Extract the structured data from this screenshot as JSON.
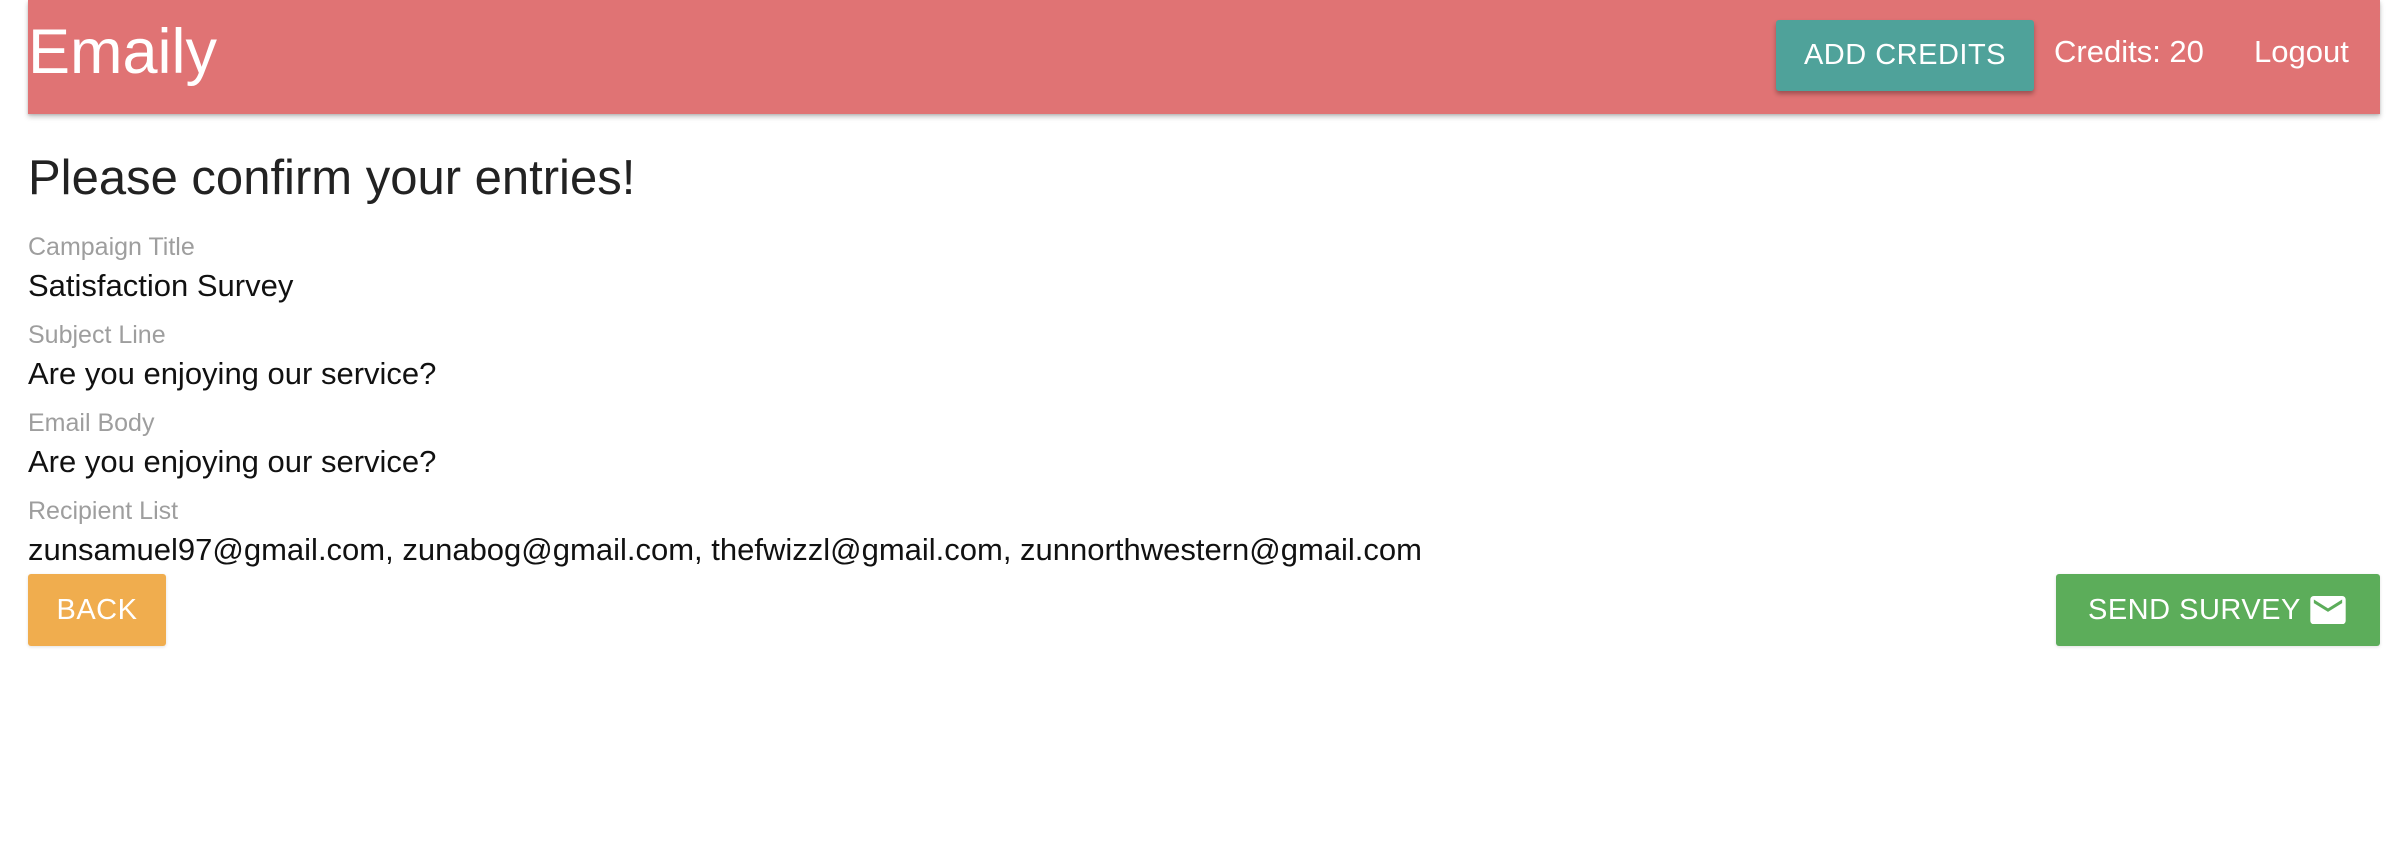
{
  "header": {
    "brand": "Emaily",
    "add_credits_label": "ADD CREDITS",
    "credits_text": "Credits: 20",
    "logout_label": "Logout"
  },
  "main": {
    "title": "Please confirm your entries!",
    "fields": [
      {
        "label": "Campaign Title",
        "value": "Satisfaction Survey"
      },
      {
        "label": "Subject Line",
        "value": "Are you enjoying our service?"
      },
      {
        "label": "Email Body",
        "value": "Are you enjoying our service?"
      },
      {
        "label": "Recipient List",
        "value": "zunsamuel97@gmail.com, zunabog@gmail.com, thefwizzl@gmail.com, zunnorthwestern@gmail.com"
      }
    ],
    "back_label": "BACK",
    "send_label": "SEND SURVEY",
    "send_icon": "mail-icon"
  },
  "colors": {
    "navbar": "#e07374",
    "add_credits": "#4fa29a",
    "back": "#f0ad4e",
    "send": "#5cad5a"
  }
}
